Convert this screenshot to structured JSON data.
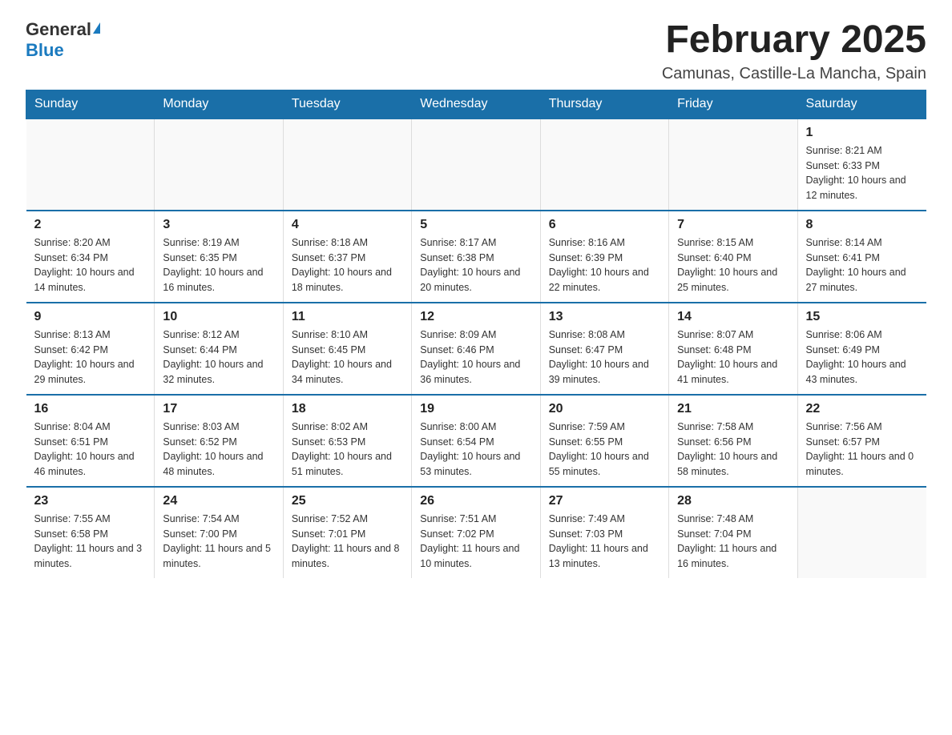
{
  "logo": {
    "general": "General",
    "blue": "Blue"
  },
  "title": "February 2025",
  "location": "Camunas, Castille-La Mancha, Spain",
  "days_of_week": [
    "Sunday",
    "Monday",
    "Tuesday",
    "Wednesday",
    "Thursday",
    "Friday",
    "Saturday"
  ],
  "weeks": [
    [
      {
        "day": "",
        "info": ""
      },
      {
        "day": "",
        "info": ""
      },
      {
        "day": "",
        "info": ""
      },
      {
        "day": "",
        "info": ""
      },
      {
        "day": "",
        "info": ""
      },
      {
        "day": "",
        "info": ""
      },
      {
        "day": "1",
        "info": "Sunrise: 8:21 AM\nSunset: 6:33 PM\nDaylight: 10 hours and 12 minutes."
      }
    ],
    [
      {
        "day": "2",
        "info": "Sunrise: 8:20 AM\nSunset: 6:34 PM\nDaylight: 10 hours and 14 minutes."
      },
      {
        "day": "3",
        "info": "Sunrise: 8:19 AM\nSunset: 6:35 PM\nDaylight: 10 hours and 16 minutes."
      },
      {
        "day": "4",
        "info": "Sunrise: 8:18 AM\nSunset: 6:37 PM\nDaylight: 10 hours and 18 minutes."
      },
      {
        "day": "5",
        "info": "Sunrise: 8:17 AM\nSunset: 6:38 PM\nDaylight: 10 hours and 20 minutes."
      },
      {
        "day": "6",
        "info": "Sunrise: 8:16 AM\nSunset: 6:39 PM\nDaylight: 10 hours and 22 minutes."
      },
      {
        "day": "7",
        "info": "Sunrise: 8:15 AM\nSunset: 6:40 PM\nDaylight: 10 hours and 25 minutes."
      },
      {
        "day": "8",
        "info": "Sunrise: 8:14 AM\nSunset: 6:41 PM\nDaylight: 10 hours and 27 minutes."
      }
    ],
    [
      {
        "day": "9",
        "info": "Sunrise: 8:13 AM\nSunset: 6:42 PM\nDaylight: 10 hours and 29 minutes."
      },
      {
        "day": "10",
        "info": "Sunrise: 8:12 AM\nSunset: 6:44 PM\nDaylight: 10 hours and 32 minutes."
      },
      {
        "day": "11",
        "info": "Sunrise: 8:10 AM\nSunset: 6:45 PM\nDaylight: 10 hours and 34 minutes."
      },
      {
        "day": "12",
        "info": "Sunrise: 8:09 AM\nSunset: 6:46 PM\nDaylight: 10 hours and 36 minutes."
      },
      {
        "day": "13",
        "info": "Sunrise: 8:08 AM\nSunset: 6:47 PM\nDaylight: 10 hours and 39 minutes."
      },
      {
        "day": "14",
        "info": "Sunrise: 8:07 AM\nSunset: 6:48 PM\nDaylight: 10 hours and 41 minutes."
      },
      {
        "day": "15",
        "info": "Sunrise: 8:06 AM\nSunset: 6:49 PM\nDaylight: 10 hours and 43 minutes."
      }
    ],
    [
      {
        "day": "16",
        "info": "Sunrise: 8:04 AM\nSunset: 6:51 PM\nDaylight: 10 hours and 46 minutes."
      },
      {
        "day": "17",
        "info": "Sunrise: 8:03 AM\nSunset: 6:52 PM\nDaylight: 10 hours and 48 minutes."
      },
      {
        "day": "18",
        "info": "Sunrise: 8:02 AM\nSunset: 6:53 PM\nDaylight: 10 hours and 51 minutes."
      },
      {
        "day": "19",
        "info": "Sunrise: 8:00 AM\nSunset: 6:54 PM\nDaylight: 10 hours and 53 minutes."
      },
      {
        "day": "20",
        "info": "Sunrise: 7:59 AM\nSunset: 6:55 PM\nDaylight: 10 hours and 55 minutes."
      },
      {
        "day": "21",
        "info": "Sunrise: 7:58 AM\nSunset: 6:56 PM\nDaylight: 10 hours and 58 minutes."
      },
      {
        "day": "22",
        "info": "Sunrise: 7:56 AM\nSunset: 6:57 PM\nDaylight: 11 hours and 0 minutes."
      }
    ],
    [
      {
        "day": "23",
        "info": "Sunrise: 7:55 AM\nSunset: 6:58 PM\nDaylight: 11 hours and 3 minutes."
      },
      {
        "day": "24",
        "info": "Sunrise: 7:54 AM\nSunset: 7:00 PM\nDaylight: 11 hours and 5 minutes."
      },
      {
        "day": "25",
        "info": "Sunrise: 7:52 AM\nSunset: 7:01 PM\nDaylight: 11 hours and 8 minutes."
      },
      {
        "day": "26",
        "info": "Sunrise: 7:51 AM\nSunset: 7:02 PM\nDaylight: 11 hours and 10 minutes."
      },
      {
        "day": "27",
        "info": "Sunrise: 7:49 AM\nSunset: 7:03 PM\nDaylight: 11 hours and 13 minutes."
      },
      {
        "day": "28",
        "info": "Sunrise: 7:48 AM\nSunset: 7:04 PM\nDaylight: 11 hours and 16 minutes."
      },
      {
        "day": "",
        "info": ""
      }
    ]
  ]
}
